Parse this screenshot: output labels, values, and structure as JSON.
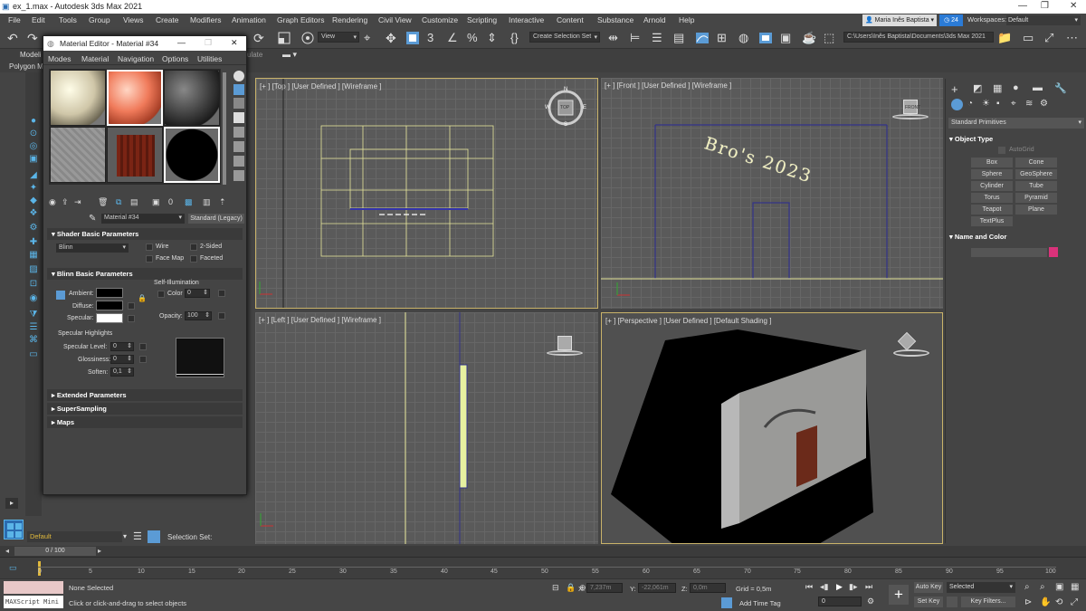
{
  "window": {
    "title": "ex_1.max - Autodesk 3ds Max 2021"
  },
  "menu": [
    "File",
    "Edit",
    "Tools",
    "Group",
    "Views",
    "Create",
    "Modifiers",
    "Animation",
    "Graph Editors",
    "Rendering",
    "Civil View",
    "Customize",
    "Scripting",
    "Interactive",
    "Content",
    "Substance",
    "Arnold",
    "Help"
  ],
  "user": {
    "name": "Maria Inês Baptista",
    "badge": "24",
    "workspace_label": "Workspaces:",
    "workspace": "Default"
  },
  "toolbar": {
    "view_dropdown": "View",
    "selection_set": "Create Selection Set",
    "path": "C:\\Users\\Inês Baptista\\Documents\\3ds Max 2021"
  },
  "ribbon": {
    "tab1": "Modeli",
    "tab2": "Polygon M",
    "populate": "ulate"
  },
  "viewports": {
    "top": "[+ ] [Top ] [User Defined ] [Wireframe ]",
    "front": "[+ ] [Front ] [User Defined ] [Wireframe ]",
    "left": "[+ ] [Left ] [User Defined ] [Wireframe ]",
    "perspective": "[+ ] [Perspective ] [User Defined ] [Default Shading ]",
    "front_text": "Bro's 2023",
    "viewcube_top": "TOP",
    "viewcube_front": "FRONT",
    "compass": {
      "n": "N",
      "e": "E",
      "w": "W",
      "s": "S"
    }
  },
  "command_panel": {
    "category": "Standard Primitives",
    "object_type_title": "Object Type",
    "autogrid": "AutoGrid",
    "buttons": [
      "Box",
      "Cone",
      "Sphere",
      "GeoSphere",
      "Cylinder",
      "Tube",
      "Torus",
      "Pyramid",
      "Teapot",
      "Plane",
      "TextPlus"
    ],
    "name_color_title": "Name and Color",
    "swatch_color": "#d9327a"
  },
  "material_editor": {
    "title": "Material Editor - Material #34",
    "menu": [
      "Modes",
      "Material",
      "Navigation",
      "Options",
      "Utilities"
    ],
    "material_name": "Material #34",
    "material_type": "Standard (Legacy)",
    "shader_rollout": "Shader Basic Parameters",
    "shader": "Blinn",
    "wire": "Wire",
    "two_sided": "2-Sided",
    "face_map": "Face Map",
    "faceted": "Faceted",
    "blinn_rollout": "Blinn Basic Parameters",
    "self_illum": "Self-Illumination",
    "ambient": "Ambient:",
    "diffuse": "Diffuse:",
    "specular": "Specular:",
    "color_label": "Color",
    "color_value": "0",
    "opacity_label": "Opacity:",
    "opacity_value": "100",
    "spec_highlights": "Specular Highlights",
    "spec_level": "Specular Level:",
    "spec_level_value": "0",
    "glossiness": "Glossiness:",
    "glossiness_value": "0",
    "soften": "Soften:",
    "soften_value": "0,1",
    "extended": "Extended Parameters",
    "supersampling": "SuperSampling",
    "maps": "Maps"
  },
  "bottom": {
    "layer": "Default",
    "selection_set": "Selection Set:",
    "frame_range": "0 / 100",
    "ticks": [
      "0",
      "5",
      "10",
      "15",
      "20",
      "25",
      "30",
      "35",
      "40",
      "45",
      "50",
      "55",
      "60",
      "65",
      "70",
      "75",
      "80",
      "85",
      "90",
      "95",
      "100"
    ],
    "maxscript": "MAXScript Mini",
    "none_selected": "None Selected",
    "prompt": "Click or click-and-drag to select objects",
    "x_label": "X:",
    "x_value": "7,237m",
    "y_label": "Y:",
    "y_value": "-22,061m",
    "z_label": "Z:",
    "z_value": "0,0m",
    "grid": "Grid = 0,5m",
    "add_time_tag": "Add Time Tag",
    "auto_key": "Auto Key",
    "set_key": "Set Key",
    "selected": "Selected",
    "key_filters": "Key Filters...",
    "frame": "0"
  }
}
